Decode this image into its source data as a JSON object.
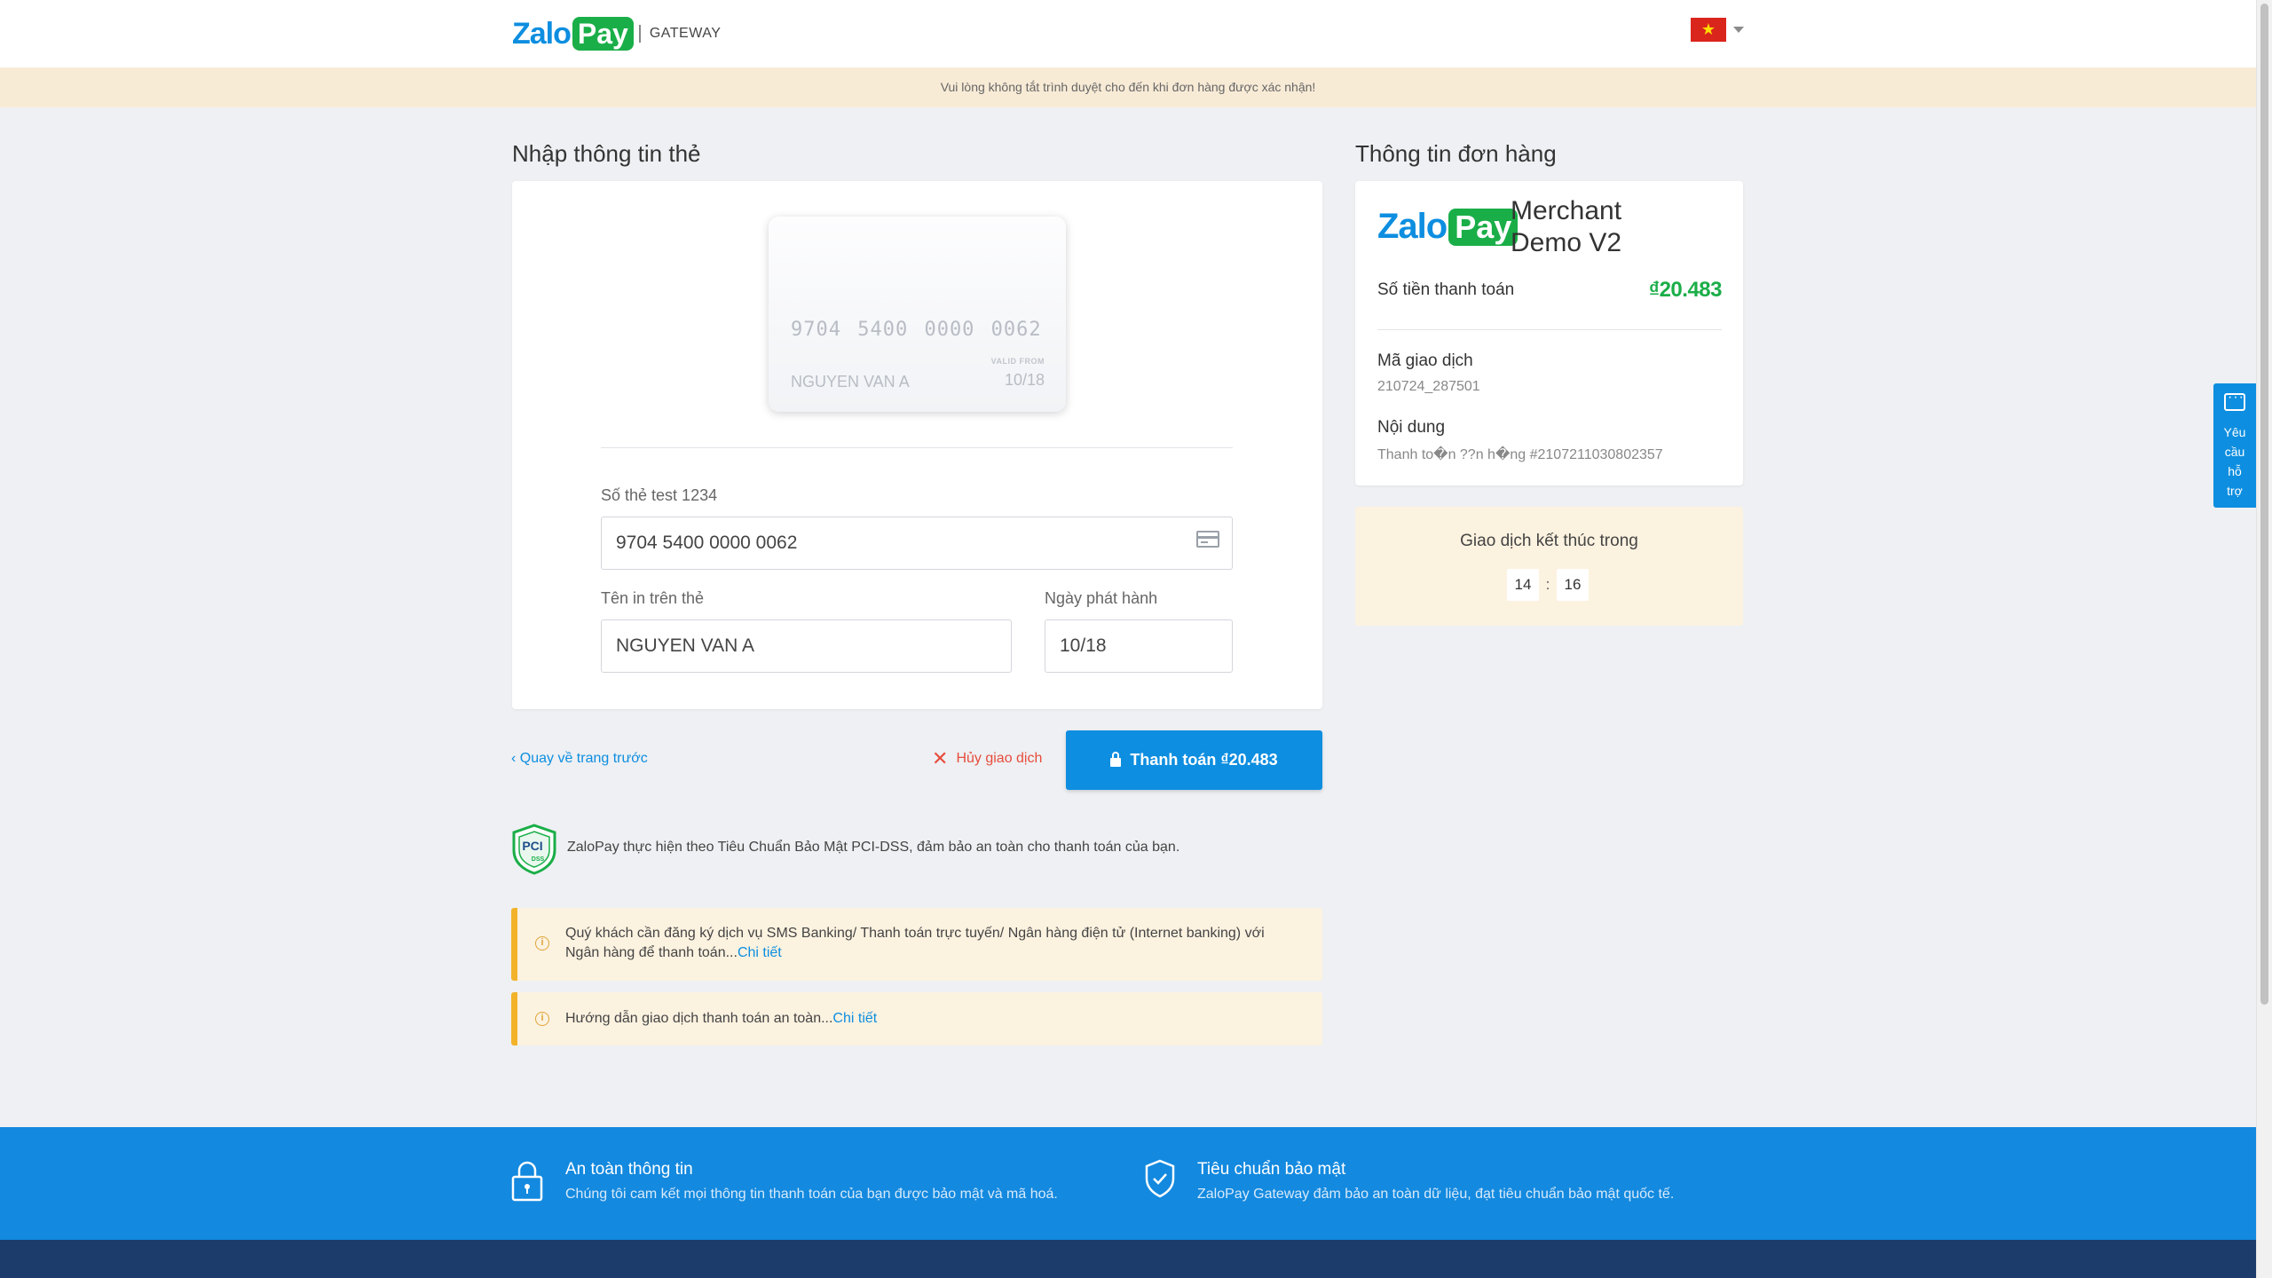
{
  "header": {
    "logo_zalo": "Zalo",
    "logo_pay": "Pay",
    "gateway": "GATEWAY",
    "flag_star": "★"
  },
  "notice": "Vui lòng không tắt trình duyệt cho đến khi đơn hàng được xác nhận!",
  "card_form": {
    "title": "Nhập thông tin thẻ",
    "card_preview": {
      "number": "9704 5400 0000 0062",
      "name": "NGUYEN VAN A",
      "valid_label": "VALID FROM",
      "valid": "10/18"
    },
    "card_number_label": "Số thẻ test 1234",
    "card_number_value": "9704 5400 0000 0062",
    "name_label": "Tên in trên thẻ",
    "name_value": "NGUYEN VAN A",
    "issue_date_label": "Ngày phát hành",
    "issue_date_value": "10/18"
  },
  "actions": {
    "back": "‹ Quay về trang trước",
    "cancel_icon": "✕",
    "cancel": "Hủy giao dịch",
    "pay": "Thanh toán ₫20.483"
  },
  "pci": {
    "badge_top": "PCI",
    "badge_bottom": "DSS",
    "text": "ZaloPay thực hiện theo Tiêu Chuẩn Bảo Mật PCI-DSS, đảm bảo an toàn cho thanh toán của bạn."
  },
  "info": [
    {
      "icon": "i",
      "line1": "Quý khách cần đăng ký dịch vụ SMS Banking/ Thanh toán trực tuyến/ Ngân hàng điện tử (Internet banking) với",
      "line2": "Ngân hàng để thanh toán...",
      "link": "Chi tiết"
    },
    {
      "icon": "i",
      "text": "Hướng dẫn giao dịch thanh toán an toàn...",
      "link": "Chi tiết"
    }
  ],
  "order": {
    "title": "Thông tin đơn hàng",
    "logo_zalo": "Zalo",
    "logo_pay": "Pay",
    "merchant": "Merchant Demo V2",
    "amount_label": "Số tiền thanh toán",
    "amount": "₫20.483",
    "txn_label": "Mã giao dịch",
    "txn_value": "210724_287501",
    "content_label": "Nội dung",
    "content_value": "Thanh to�n ??n h�ng #2107211030802357"
  },
  "countdown": {
    "title": "Giao dịch kết thúc trong",
    "minutes": "14",
    "separator": ":",
    "seconds": "16"
  },
  "support": {
    "label_lines": [
      "Yêu",
      "cầu",
      "hỗ",
      "trợ"
    ]
  },
  "footer": {
    "security_title": "An toàn thông tin",
    "security_text": "Chúng tôi cam kết mọi thông tin thanh toán của bạn được bảo mật và mã hoá.",
    "standard_title": "Tiêu chuẩn bảo mật",
    "standard_text": "ZaloPay Gateway đảm bảo an toàn dữ liệu, đạt tiêu chuẩn bảo mật quốc tế."
  },
  "colors": {
    "brand_blue": "#0d8ee0",
    "brand_green": "#1aae48",
    "notice_bg": "#f8ebd6",
    "cancel_red": "#e74c3c",
    "footer_blue": "#1389df",
    "footer_dark": "#1c3d6c"
  }
}
